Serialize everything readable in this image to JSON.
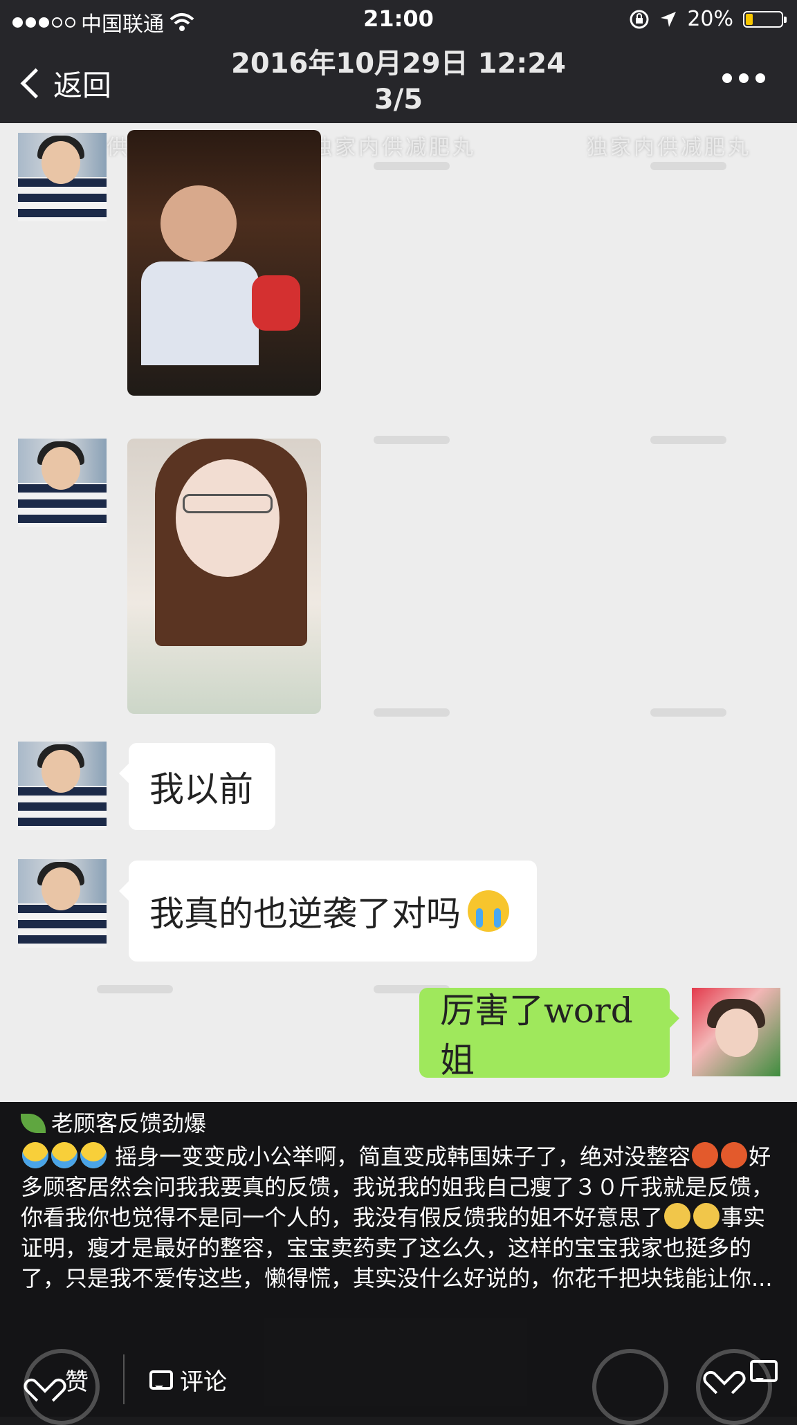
{
  "status_bar": {
    "carrier": "中国联通",
    "time": "21:00",
    "battery_percent": "20%",
    "battery_level": 0.2,
    "signal_bars_filled": 3,
    "signal_bars_total": 5
  },
  "nav": {
    "back_label": "返回",
    "date_line": "2016年10月29日 12:24",
    "page_counter": "3/5"
  },
  "screenshot": {
    "watermarks": [
      "独家内供减肥丸",
      "独家内供减肥丸",
      "独家内供减肥丸"
    ],
    "messages": [
      {
        "side": "left",
        "type": "image",
        "desc": "photo"
      },
      {
        "side": "left",
        "type": "image",
        "desc": "photo"
      },
      {
        "side": "left",
        "type": "text",
        "text": "我以前"
      },
      {
        "side": "left",
        "type": "text",
        "text": "我真的也逆袭了对吗"
      },
      {
        "side": "right",
        "type": "text",
        "text": "厉害了word姐"
      }
    ]
  },
  "post": {
    "title": "老顾客反馈劲爆",
    "body_part1": "摇身一变变成小公举啊，简直变成韩国妹子了，绝对没整容",
    "body_part2": "好多顾客居然会问我我要真的反馈，我说我的姐我自己瘦了３０斤我就是反馈，你看我你也觉得不是同一个人的，我没有假反馈我的姐不好意思了",
    "body_part3": "事实证明，瘦才是最好的整容，宝宝卖药卖了这么久，这样的宝宝我家也挺多的了，只是我不爱传这些，懒得慌，其实没什么好说的，你花千把块钱能让你..."
  },
  "actions": {
    "like_label": "赞",
    "comment_label": "评论"
  },
  "colors": {
    "bar_bg": "#26262a",
    "chat_bg": "#ededed",
    "green_bubble": "#9fe85c",
    "battery_fill": "#f7c600"
  }
}
